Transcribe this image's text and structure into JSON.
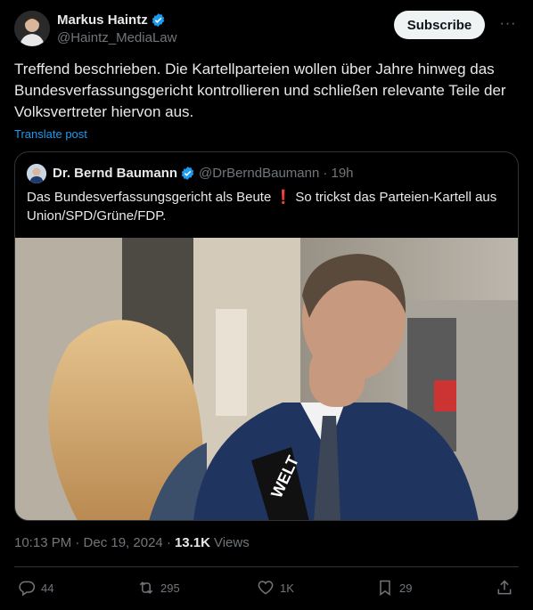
{
  "author": {
    "name": "Markus Haintz",
    "handle": "@Haintz_MediaLaw"
  },
  "header": {
    "subscribe_label": "Subscribe",
    "more_label": "···"
  },
  "post": {
    "text": "Treffend beschrieben. Die Kartellparteien wollen über Jahre hinweg das Bundesverfassungsgericht kontrollieren und schließen relevante Teile der Volksvertreter hiervon aus.",
    "translate_label": "Translate post"
  },
  "quote": {
    "name": "Dr. Bernd Baumann",
    "handle": "@DrBerndBaumann",
    "time": "· 19h",
    "text": "Das Bundesverfassungsgericht als Beute ❗ So trickst das Parteien-Kartell aus Union/SPD/Grüne/FDP.",
    "media": {
      "microphone_logo": "WELT"
    }
  },
  "meta": {
    "time": "10:13 PM · Dec 19, 2024 ·",
    "views_count": "13.1K",
    "views_label": "Views"
  },
  "actions": {
    "replies": "44",
    "reposts": "295",
    "likes": "1K",
    "bookmarks": "29"
  },
  "colors": {
    "background": "#000000",
    "accent": "#1d9bf0",
    "muted": "#71767b",
    "text": "#e7e9ea",
    "border": "#2f3336"
  },
  "icons": {
    "verified": "verified-badge-icon",
    "reply": "reply-icon",
    "repost": "repost-icon",
    "like": "heart-icon",
    "bookmark": "bookmark-icon",
    "share": "share-icon"
  }
}
